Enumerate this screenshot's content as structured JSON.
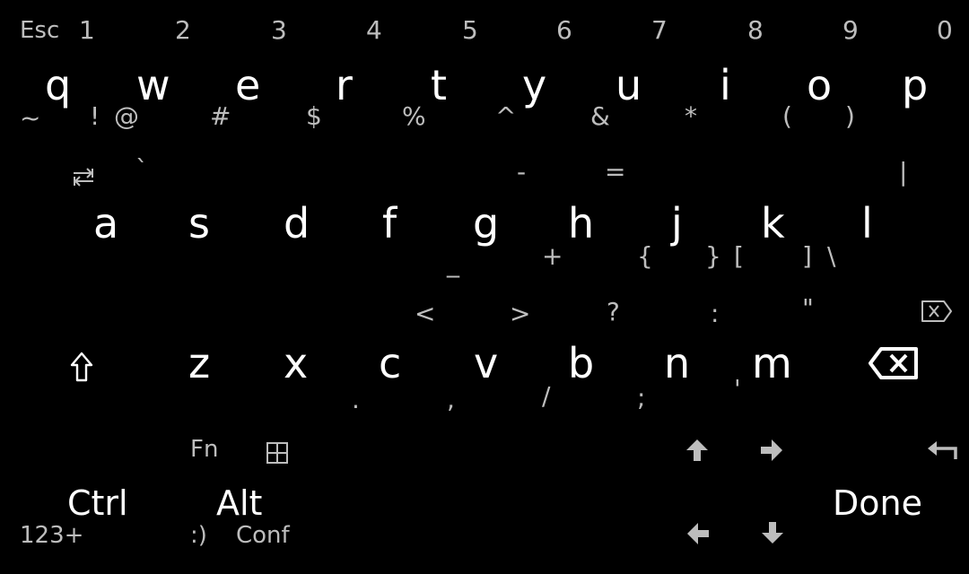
{
  "colors": {
    "background": "#000000",
    "main_label": "#ffffff",
    "secondary_label": "#bdbdbd"
  },
  "keyboard": {
    "row1": [
      {
        "main": "q",
        "tl": "Esc",
        "tr": "1",
        "bl": "~"
      },
      {
        "main": "w",
        "tr": "2",
        "bl": "!",
        "br": "@"
      },
      {
        "main": "e",
        "tr": "3",
        "bl": "#"
      },
      {
        "main": "r",
        "tr": "4",
        "bl": "$"
      },
      {
        "main": "t",
        "tr": "5",
        "bl": "%"
      },
      {
        "main": "y",
        "tr": "6",
        "bl": "^"
      },
      {
        "main": "u",
        "tr": "7",
        "bl": "&"
      },
      {
        "main": "i",
        "tr": "8",
        "bl": "*"
      },
      {
        "main": "o",
        "tr": "9",
        "bl": "("
      },
      {
        "main": "p",
        "tr": "0",
        "bl": ")"
      }
    ],
    "row2": [
      {
        "main": "a",
        "tl_icon": "tab-icon",
        "tr": "`"
      },
      {
        "main": "s"
      },
      {
        "main": "d"
      },
      {
        "main": "f"
      },
      {
        "main": "g",
        "tl": "-",
        "bl": "_"
      },
      {
        "main": "h",
        "tl": "=",
        "bl": "+"
      },
      {
        "main": "j",
        "bl": "{"
      },
      {
        "main": "k",
        "bl": "}",
        "br": "["
      },
      {
        "main": "l",
        "tr": "|",
        "bl": "]",
        "br": "\\"
      }
    ],
    "row3": [
      {
        "icon": "shift-icon"
      },
      {
        "main": "z"
      },
      {
        "main": "x"
      },
      {
        "main": "c",
        "bl": "."
      },
      {
        "main": "v",
        "tl": "<",
        "bl": ","
      },
      {
        "main": "b",
        "tl": ">",
        "bl": "/"
      },
      {
        "main": "n",
        "tl": "?",
        "bl": ";"
      },
      {
        "main": "m",
        "tl": ":",
        "bl": "'",
        "tr": "\""
      },
      {
        "icon": "backspace-icon",
        "tr_icon": "delete-icon"
      }
    ],
    "row4": [
      {
        "main": "Ctrl",
        "bl": "123+"
      },
      {
        "main": "Alt",
        "tl": "Fn",
        "tr_icon": "emoji-grid-icon",
        "bl": ":)",
        "br": "Conf"
      },
      {
        "icons": [
          "arrow-up-icon",
          "arrow-right-icon",
          "arrow-left-icon",
          "arrow-down-icon"
        ]
      },
      {
        "main": "Done",
        "tr_icon": "return-icon"
      }
    ]
  }
}
